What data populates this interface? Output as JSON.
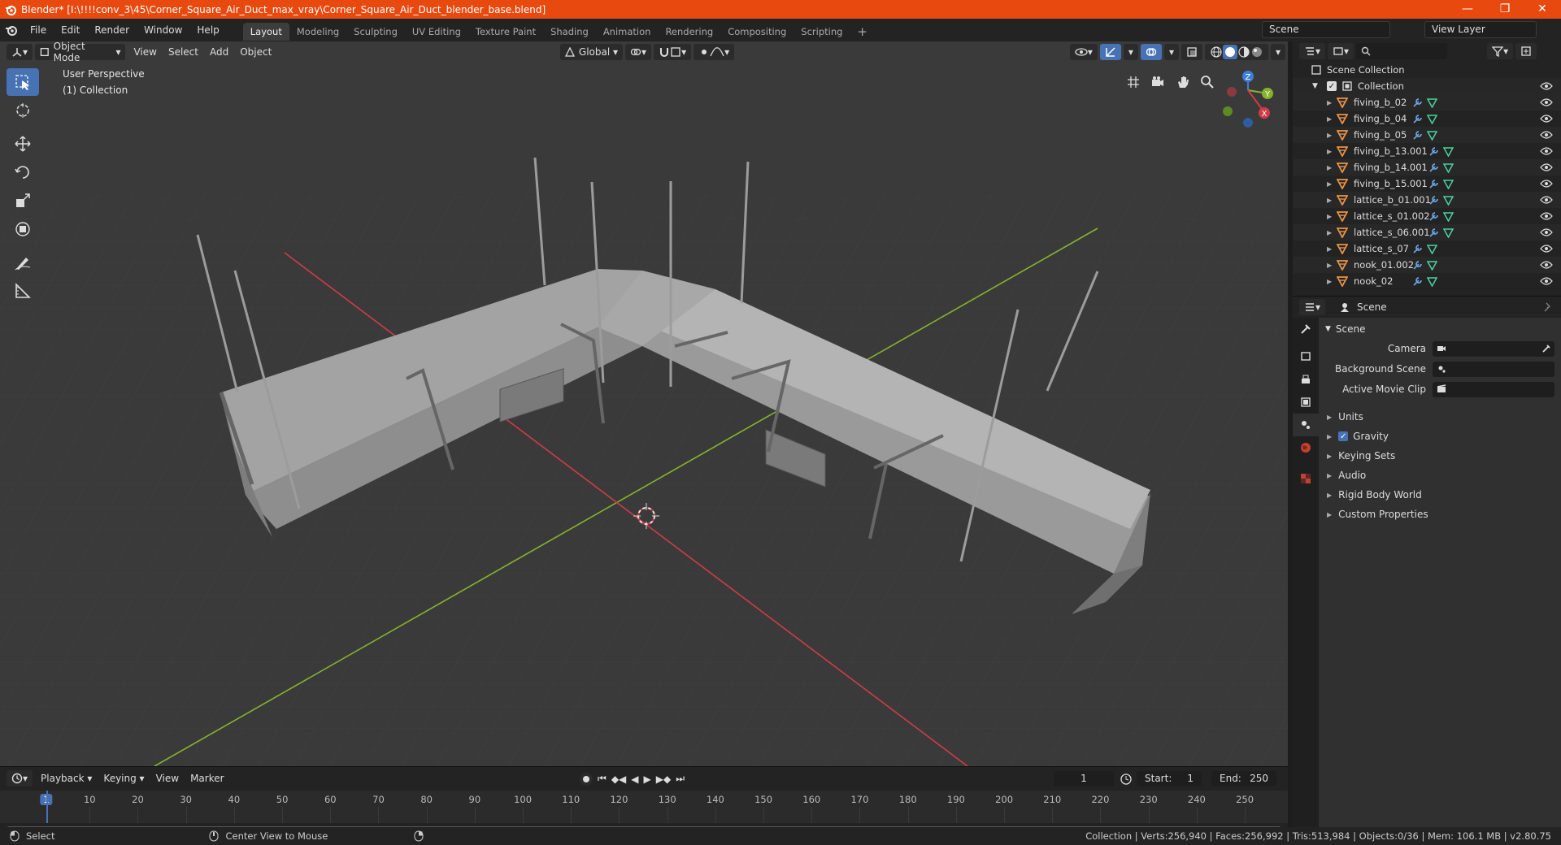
{
  "window": {
    "title": "Blender* [I:\\!!!!conv_3\\45\\Corner_Square_Air_Duct_max_vray\\Corner_Square_Air_Duct_blender_base.blend]",
    "minimize": "—",
    "maximize": "❐",
    "close": "✕"
  },
  "menu": [
    "File",
    "Edit",
    "Render",
    "Window",
    "Help"
  ],
  "workspaces": [
    "Layout",
    "Modeling",
    "Sculpting",
    "UV Editing",
    "Texture Paint",
    "Shading",
    "Animation",
    "Rendering",
    "Compositing",
    "Scripting"
  ],
  "active_workspace": "Layout",
  "scene_name": "Scene",
  "view_layer": "View Layer",
  "viewport": {
    "mode": "Object Mode",
    "menus": [
      "View",
      "Select",
      "Add",
      "Object"
    ],
    "orientation": "Global",
    "perspective_label": "User Perspective",
    "collection_label": "(1) Collection",
    "gizmo_axes": {
      "x": "X",
      "y": "Y",
      "z": "Z"
    }
  },
  "outliner": {
    "root": "Scene Collection",
    "collection": "Collection",
    "items": [
      "fiving_b_02",
      "fiving_b_04",
      "fiving_b_05",
      "fiving_b_13.001",
      "fiving_b_14.001",
      "fiving_b_15.001",
      "lattice_b_01.001",
      "lattice_s_01.002",
      "lattice_s_06.001",
      "lattice_s_07",
      "nook_01.002",
      "nook_02"
    ]
  },
  "properties": {
    "header": "Scene",
    "section": "Scene",
    "fields": [
      {
        "label": "Camera"
      },
      {
        "label": "Background Scene"
      },
      {
        "label": "Active Movie Clip"
      }
    ],
    "panels": [
      {
        "label": "Units",
        "checkbox": false
      },
      {
        "label": "Gravity",
        "checkbox": true
      },
      {
        "label": "Keying Sets",
        "checkbox": false
      },
      {
        "label": "Audio",
        "checkbox": false
      },
      {
        "label": "Rigid Body World",
        "checkbox": false
      },
      {
        "label": "Custom Properties",
        "checkbox": false
      }
    ]
  },
  "timeline": {
    "menus": [
      "Playback",
      "Keying",
      "View",
      "Marker"
    ],
    "current_frame": "1",
    "start_label": "Start:",
    "start": "1",
    "end_label": "End:",
    "end": "250",
    "ticks": [
      "1",
      "10",
      "20",
      "30",
      "40",
      "50",
      "60",
      "70",
      "80",
      "90",
      "100",
      "110",
      "120",
      "130",
      "140",
      "150",
      "160",
      "170",
      "180",
      "190",
      "200",
      "210",
      "220",
      "230",
      "240",
      "250"
    ]
  },
  "status": {
    "left_action": "Select",
    "middle_action": "Center View to Mouse",
    "stats": "Collection | Verts:256,940 | Faces:256,992 | Tris:513,984 | Objects:0/36 | Mem: 106.1 MB | v2.80.75"
  },
  "colors": {
    "title_bar": "#e8490f",
    "accent": "#4772b3",
    "x_axis": "#d13b47",
    "y_axis": "#86b22d",
    "z_axis": "#3d7fd9"
  }
}
